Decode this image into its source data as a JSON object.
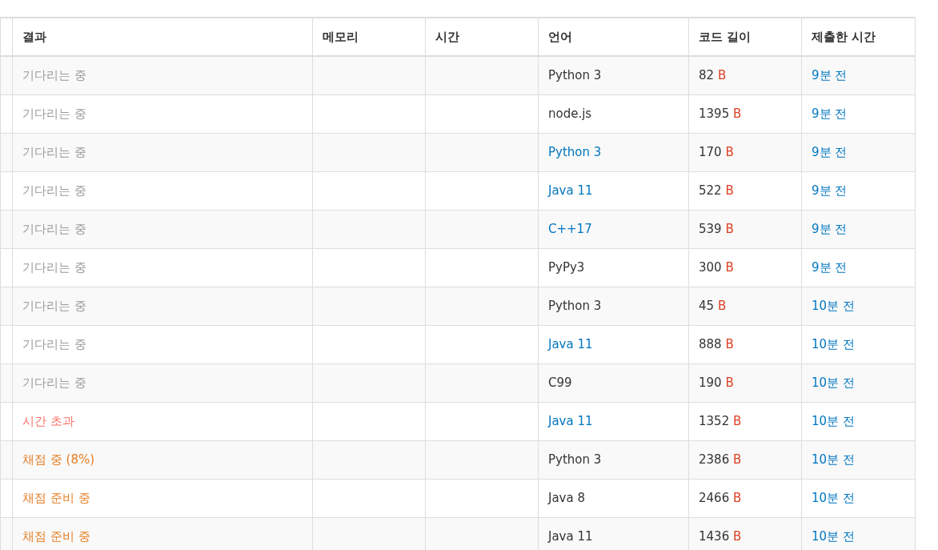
{
  "table": {
    "columns": [
      "결과",
      "메모리",
      "시간",
      "언어",
      "코드 길이",
      "제출한 시간"
    ],
    "rows": [
      {
        "result": "기다리는 중",
        "kind": "waiting",
        "language": "Python 3",
        "language_linked": false,
        "length": "82",
        "unit": "B",
        "submitted": "9분 전"
      },
      {
        "result": "기다리는 중",
        "kind": "waiting",
        "language": "node.js",
        "language_linked": false,
        "length": "1395",
        "unit": "B",
        "submitted": "9분 전"
      },
      {
        "result": "기다리는 중",
        "kind": "waiting",
        "language": "Python 3",
        "language_linked": true,
        "length": "170",
        "unit": "B",
        "submitted": "9분 전"
      },
      {
        "result": "기다리는 중",
        "kind": "waiting",
        "language": "Java 11",
        "language_linked": true,
        "length": "522",
        "unit": "B",
        "submitted": "9분 전"
      },
      {
        "result": "기다리는 중",
        "kind": "waiting",
        "language": "C++17",
        "language_linked": true,
        "length": "539",
        "unit": "B",
        "submitted": "9분 전"
      },
      {
        "result": "기다리는 중",
        "kind": "waiting",
        "language": "PyPy3",
        "language_linked": false,
        "length": "300",
        "unit": "B",
        "submitted": "9분 전"
      },
      {
        "result": "기다리는 중",
        "kind": "waiting",
        "language": "Python 3",
        "language_linked": false,
        "length": "45",
        "unit": "B",
        "submitted": "10분 전"
      },
      {
        "result": "기다리는 중",
        "kind": "waiting",
        "language": "Java 11",
        "language_linked": true,
        "length": "888",
        "unit": "B",
        "submitted": "10분 전"
      },
      {
        "result": "기다리는 중",
        "kind": "waiting",
        "language": "C99",
        "language_linked": false,
        "length": "190",
        "unit": "B",
        "submitted": "10분 전"
      },
      {
        "result": "시간 초과",
        "kind": "time_limit",
        "language": "Java 11",
        "language_linked": true,
        "length": "1352",
        "unit": "B",
        "submitted": "10분 전"
      },
      {
        "result": "채점 중 (8%)",
        "kind": "judging",
        "language": "Python 3",
        "language_linked": false,
        "length": "2386",
        "unit": "B",
        "submitted": "10분 전"
      },
      {
        "result": "채점 준비 중",
        "kind": "judging",
        "language": "Java 8",
        "language_linked": false,
        "length": "2466",
        "unit": "B",
        "submitted": "10분 전"
      },
      {
        "result": "채점 준비 중",
        "kind": "judging",
        "language": "Java 11",
        "language_linked": false,
        "length": "1436",
        "unit": "B",
        "submitted": "10분 전"
      }
    ]
  }
}
